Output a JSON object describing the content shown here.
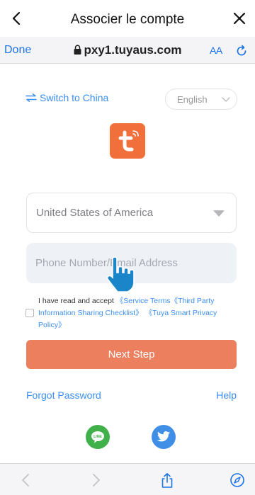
{
  "titlebar": {
    "title": "Associer le compte"
  },
  "urlbar": {
    "done_label": "Done",
    "domain": "pxy1.tuyaus.com",
    "text_size_label": "AA"
  },
  "page": {
    "switch_region_label": "Switch to China",
    "language_selected": "English",
    "country_selected": "United States of America",
    "phone_placeholder": "Phone Number/Email Address",
    "terms_prefix": "I have read and accept ",
    "terms_service_link": "《Service Terms",
    "terms_third_party_link": "《Third Party Information Sharing Checklist》",
    "terms_privacy_link": "《Tuya Smart Privacy Policy》",
    "next_step_label": "Next Step",
    "forgot_password_label": "Forgot Password",
    "help_label": "Help"
  },
  "social": {
    "line_text": "LINE"
  },
  "colors": {
    "accent": "#3b8ef3",
    "primary_button": "#ec7f5e",
    "logo": "#f06f3b",
    "line": "#3fb04a",
    "twitter": "#3f8fe6"
  }
}
